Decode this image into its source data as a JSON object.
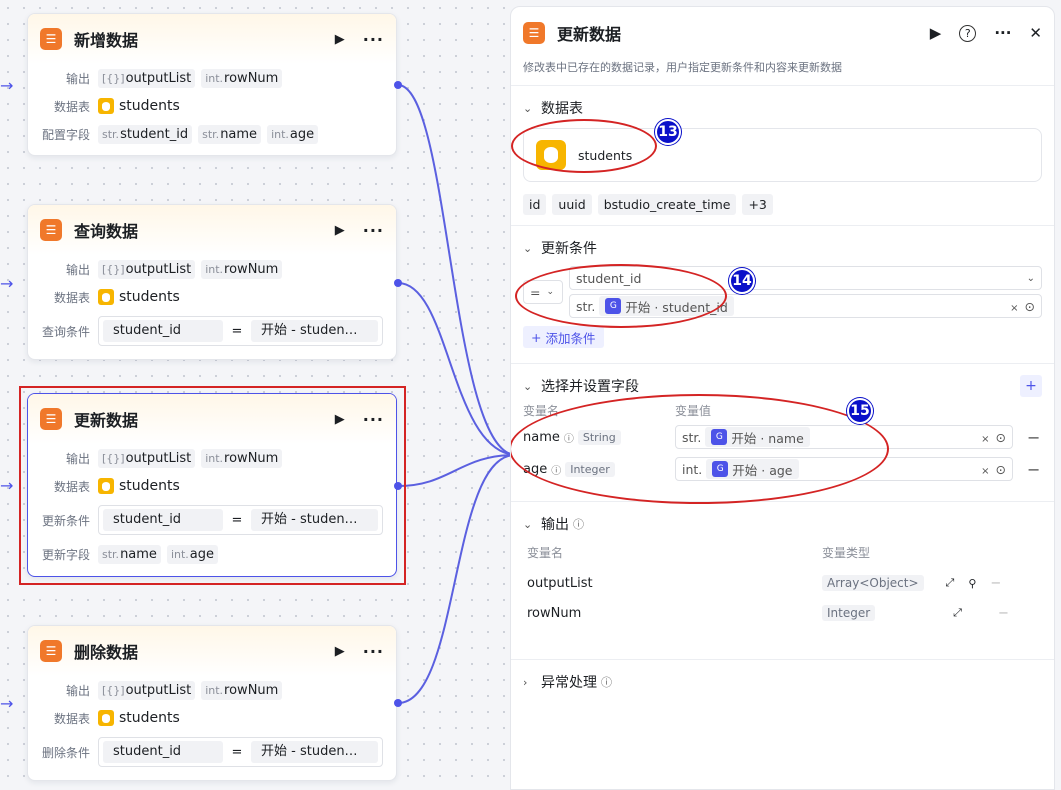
{
  "nodes": [
    {
      "title": "新增数据",
      "output_label": "输出",
      "outputs": [
        {
          "type": "[{}]",
          "name": "outputList"
        },
        {
          "type": "int.",
          "name": "rowNum"
        }
      ],
      "table_label": "数据表",
      "table": "students",
      "extra_label": "配置字段",
      "extra_tags": [
        {
          "type": "str.",
          "name": "student_id"
        },
        {
          "type": "str.",
          "name": "name"
        },
        {
          "type": "int.",
          "name": "age"
        }
      ]
    },
    {
      "title": "查询数据",
      "output_label": "输出",
      "outputs": [
        {
          "type": "[{}]",
          "name": "outputList"
        },
        {
          "type": "int.",
          "name": "rowNum"
        }
      ],
      "table_label": "数据表",
      "table": "students",
      "cond_label": "查询条件",
      "cond": {
        "field": "student_id",
        "op": "=",
        "value": "开始 - studen…"
      }
    },
    {
      "title": "更新数据",
      "output_label": "输出",
      "outputs": [
        {
          "type": "[{}]",
          "name": "outputList"
        },
        {
          "type": "int.",
          "name": "rowNum"
        }
      ],
      "table_label": "数据表",
      "table": "students",
      "cond_label": "更新条件",
      "cond": {
        "field": "student_id",
        "op": "=",
        "value": "开始 - studen…"
      },
      "extra_label": "更新字段",
      "extra_tags": [
        {
          "type": "str.",
          "name": "name"
        },
        {
          "type": "int.",
          "name": "age"
        }
      ]
    },
    {
      "title": "删除数据",
      "output_label": "输出",
      "outputs": [
        {
          "type": "[{}]",
          "name": "outputList"
        },
        {
          "type": "int.",
          "name": "rowNum"
        }
      ],
      "table_label": "数据表",
      "table": "students",
      "cond_label": "删除条件",
      "cond": {
        "field": "student_id",
        "op": "=",
        "value": "开始 - studen…"
      }
    }
  ],
  "panel": {
    "title": "更新数据",
    "description": "修改表中已存在的数据记录，用户指定更新条件和内容来更新数据",
    "table_section": {
      "title": "数据表",
      "table": "students",
      "fields": [
        "id",
        "uuid",
        "bstudio_create_time",
        "+3"
      ]
    },
    "condition_section": {
      "title": "更新条件",
      "operator": "=",
      "field": "student_id",
      "value_type": "str.",
      "value_ref": "开始 · student_id",
      "add_label": "添加条件"
    },
    "fields_section": {
      "title": "选择并设置字段",
      "col_name": "变量名",
      "col_value": "变量值",
      "rows": [
        {
          "name": "name",
          "type": "String",
          "value_type": "str.",
          "value_ref": "开始 · name"
        },
        {
          "name": "age",
          "type": "Integer",
          "value_type": "int.",
          "value_ref": "开始 · age"
        }
      ]
    },
    "output_section": {
      "title": "输出",
      "col_name": "变量名",
      "col_type": "变量类型",
      "rows": [
        {
          "name": "outputList",
          "type": "Array<Object>"
        },
        {
          "name": "rowNum",
          "type": "Integer"
        }
      ]
    },
    "error_section": {
      "title": "异常处理"
    }
  },
  "badges": {
    "b13": "13",
    "b14": "14",
    "b15": "15"
  },
  "colors": {
    "accent": "#4d53e8",
    "node_icon": "#f0782a",
    "db": "#f7b500",
    "highlight": "#d42424",
    "badge": "#0a10c9"
  },
  "icons": [
    "play-icon",
    "more-icon",
    "help-icon",
    "close-icon",
    "database-icon",
    "chevron-down-icon",
    "chevron-right-icon",
    "info-icon",
    "expand-icon",
    "plus-icon",
    "minus-icon",
    "clear-icon",
    "target-icon"
  ]
}
